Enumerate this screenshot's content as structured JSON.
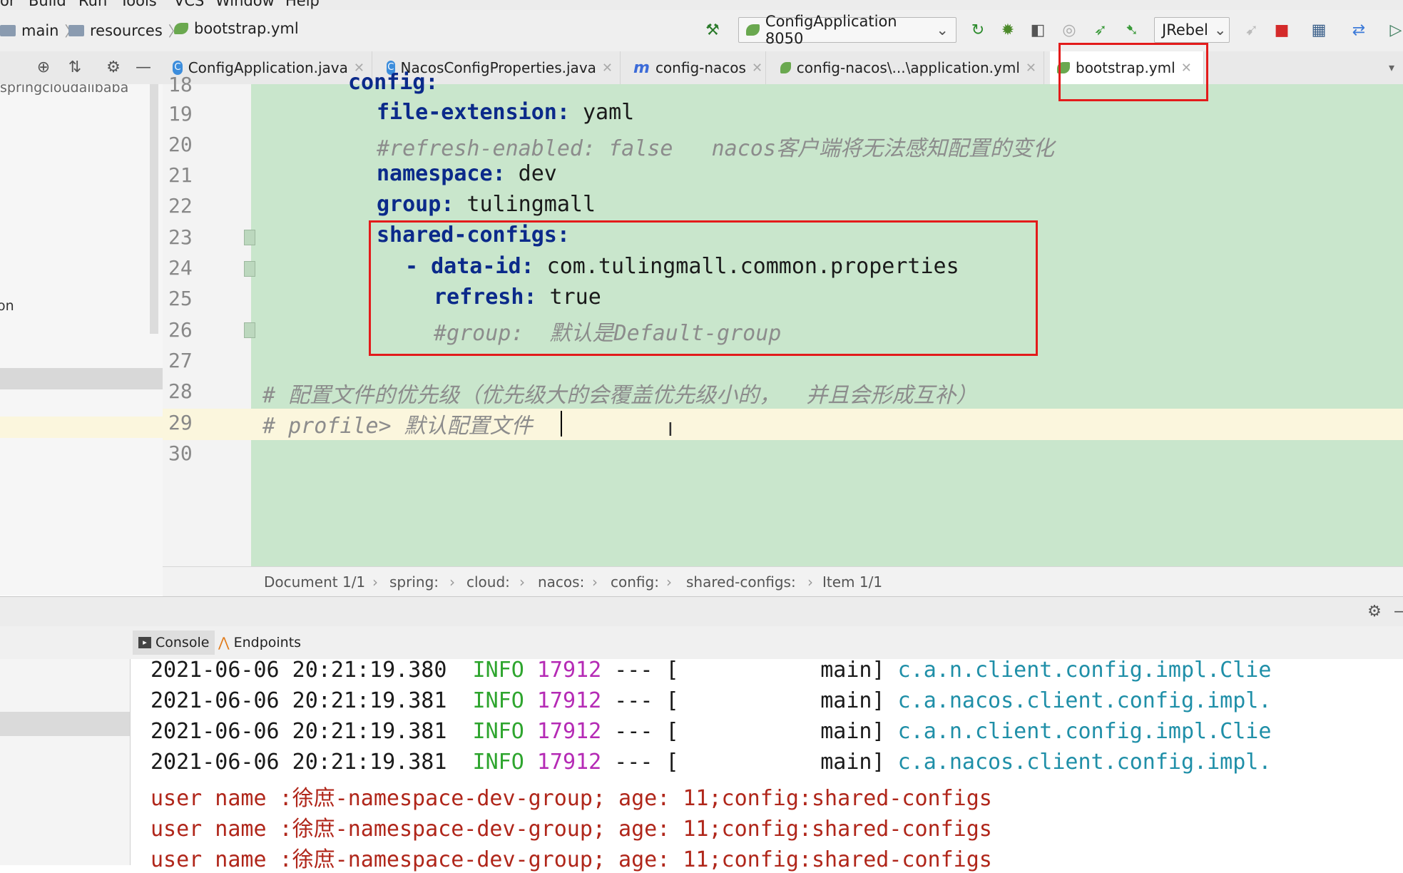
{
  "menu": [
    "or",
    "Build",
    "Run",
    "Tools",
    "VCS",
    "Window",
    "Help"
  ],
  "breadcrumbs": [
    "main",
    "resources",
    "bootstrap.yml"
  ],
  "run_config": "ConfigApplication 8050",
  "jrebel_label": "JRebel",
  "tabs": [
    {
      "label": "ConfigApplication.java",
      "icon": "class-icon"
    },
    {
      "label": "NacosConfigProperties.java",
      "icon": "class-icon"
    },
    {
      "label": "config-nacos",
      "icon": "maven-icon"
    },
    {
      "label": "config-nacos\\...\\application.yml",
      "icon": "yml-icon"
    },
    {
      "label": "bootstrap.yml",
      "icon": "yml-icon",
      "active": true
    }
  ],
  "project": {
    "label_top": "springcloudalibaba",
    "label_mid": "on"
  },
  "editor": {
    "lines": [
      {
        "n": "18",
        "text": "config:"
      },
      {
        "n": "19",
        "key": "file-extension",
        "val": " yaml"
      },
      {
        "n": "20",
        "comment": "#refresh-enabled: false   nacos客户端将无法感知配置的变化"
      },
      {
        "n": "21",
        "key": "namespace",
        "val": " dev"
      },
      {
        "n": "22",
        "key": "group",
        "val": " tulingmall"
      },
      {
        "n": "23",
        "key": "shared-configs",
        "val": ""
      },
      {
        "n": "24",
        "dash": "- ",
        "key": "data-id",
        "val": " com.tulingmall.common.properties"
      },
      {
        "n": "25",
        "key": "refresh",
        "val": " true"
      },
      {
        "n": "26",
        "comment": "#group:  默认是Default-group"
      },
      {
        "n": "27"
      },
      {
        "n": "28",
        "comment": "# 配置文件的优先级（优先级大的会覆盖优先级小的，  并且会形成互补）"
      },
      {
        "n": "29",
        "comment": "# profile> 默认配置文件"
      },
      {
        "n": "30"
      }
    ]
  },
  "structure_path": [
    "Document 1/1",
    "spring:",
    "cloud:",
    "nacos:",
    "config:",
    "shared-configs:",
    "Item 1/1"
  ],
  "bottom_tabs": [
    "Console",
    "Endpoints"
  ],
  "console": {
    "log_lines": [
      {
        "ts": "2021-06-06 20:21:19.380",
        "level": "INFO",
        "pid": "17912",
        "sep": "--- [",
        "thread": "main]",
        "cls": "c.a.n.client.config.impl.Clie"
      },
      {
        "ts": "2021-06-06 20:21:19.381",
        "level": "INFO",
        "pid": "17912",
        "sep": "--- [",
        "thread": "main]",
        "cls": "c.a.nacos.client.config.impl."
      },
      {
        "ts": "2021-06-06 20:21:19.381",
        "level": "INFO",
        "pid": "17912",
        "sep": "--- [",
        "thread": "main]",
        "cls": "c.a.n.client.config.impl.Clie"
      },
      {
        "ts": "2021-06-06 20:21:19.381",
        "level": "INFO",
        "pid": "17912",
        "sep": "--- [",
        "thread": "main]",
        "cls": "c.a.nacos.client.config.impl."
      }
    ],
    "output_lines": [
      "user name :徐庶-namespace-dev-group; age: 11;config:shared-configs",
      "user name :徐庶-namespace-dev-group; age: 11;config:shared-configs",
      "user name :徐庶-namespace-dev-group; age: 11;config:shared-configs"
    ]
  },
  "colors": {
    "editor_bg": "#c9e6cc",
    "annotation": "#e31b1b",
    "key": "#0b2a8a",
    "info": "#2ea52e",
    "pid": "#b52ab5",
    "logger": "#1f8fa8",
    "output": "#b0261a"
  }
}
